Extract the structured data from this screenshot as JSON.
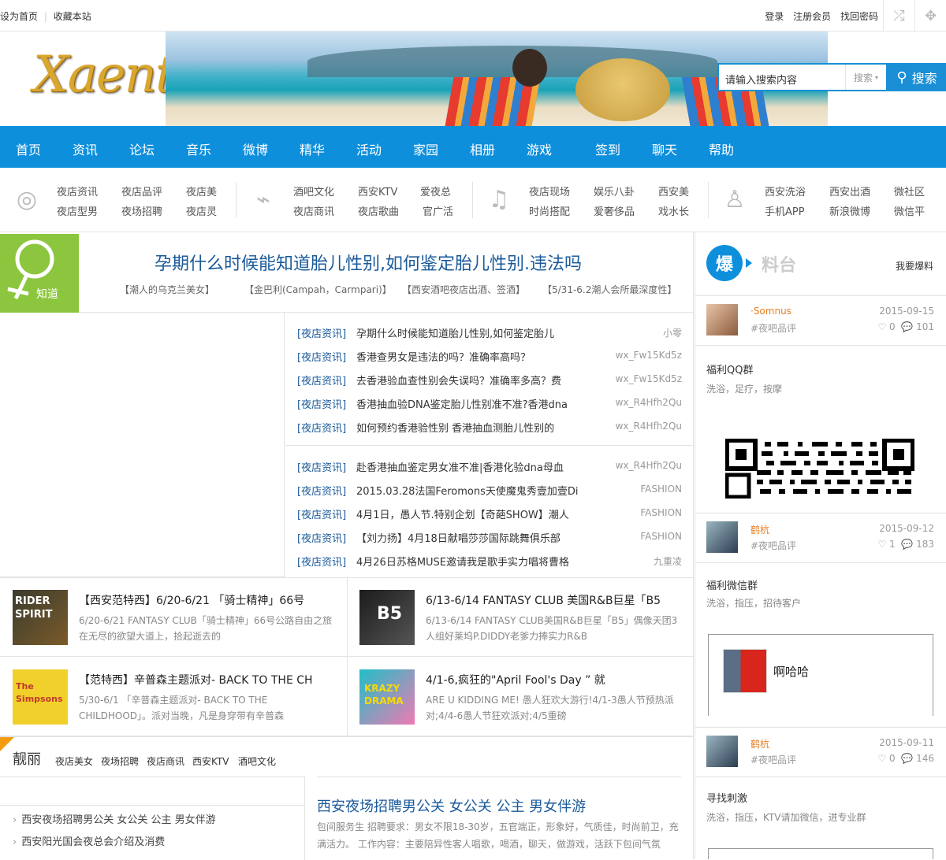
{
  "topbar": {
    "left": [
      "设为首页",
      "收藏本站"
    ],
    "right": [
      "登录",
      "注册会员",
      "找回密码"
    ]
  },
  "logo": {
    "text": "Xaent"
  },
  "search": {
    "placeholder": "请输入搜索内容",
    "select": "搜索",
    "button": "搜索"
  },
  "nav": [
    "首页",
    "资讯",
    "论坛",
    "音乐",
    "微博",
    "精华",
    "活动",
    "家园",
    "相册",
    "游戏",
    "签到",
    "聊天",
    "帮助"
  ],
  "subnav": {
    "g1": [
      "夜店资讯",
      "夜店品评",
      "夜店美",
      "夜店型男",
      "夜场招聘",
      "夜店灵"
    ],
    "g2": [
      "酒吧文化",
      "西安KTV",
      "爱夜总",
      "夜店商讯",
      "夜店歌曲",
      "官广活"
    ],
    "g3": [
      "夜店现场",
      "娱乐八卦",
      "西安美",
      "时尚搭配",
      "爱奢侈品",
      "戏水长"
    ],
    "g4": [
      "西安洗浴",
      "西安出酒",
      "微社区",
      "手机APP",
      "新浪微博",
      "微信平"
    ]
  },
  "featured": {
    "badge": "知道",
    "title": "孕期什么时候能知道胎儿性别,如何鉴定胎儿性别.违法吗",
    "tags": [
      "【潮人的乌克兰美女】",
      "【金巴利(Campah，Carmpari)】",
      "【西安酒吧夜店出酒、签酒】",
      "【5/31-6.2潮人会所最深度性】"
    ]
  },
  "news1": [
    {
      "cat": "[夜店资讯]",
      "title": "孕期什么时候能知道胎儿性别,如何鉴定胎儿",
      "author": "小零"
    },
    {
      "cat": "[夜店资讯]",
      "title": "香港查男女是违法的吗？准确率高吗？",
      "author": "wx_Fw15Kd5z"
    },
    {
      "cat": "[夜店资讯]",
      "title": "去香港验血查性别会失误吗？准确率多高？费",
      "author": "wx_Fw15Kd5z"
    },
    {
      "cat": "[夜店资讯]",
      "title": "香港抽血验DNA鉴定胎儿性别准不准?香港dna",
      "author": "wx_R4Hfh2Qu"
    },
    {
      "cat": "[夜店资讯]",
      "title": "如何预约香港验性别 香港抽血测胎儿性别的",
      "author": "wx_R4Hfh2Qu"
    }
  ],
  "news2": [
    {
      "cat": "[夜店资讯]",
      "title": "赴香港抽血鉴定男女准不准|香港化验dna母血",
      "author": "wx_R4Hfh2Qu"
    },
    {
      "cat": "[夜店资讯]",
      "title": "2015.03.28法国Feromons天使魔鬼秀壹加壹Di",
      "author": "FASHION"
    },
    {
      "cat": "[夜店资讯]",
      "title": "4月1日，愚人节.特别企划【奇葩SHOW】潮人",
      "author": "FASHION"
    },
    {
      "cat": "[夜店资讯]",
      "title": "【刘力扬】4月18日献唱莎莎国际跳舞俱乐部",
      "author": "FASHION"
    },
    {
      "cat": "[夜店资讯]",
      "title": "4月26日苏格MUSE邀请我是歌手实力唱将曹格",
      "author": "九重凌"
    }
  ],
  "cards": [
    {
      "title": "【西安范特西】6/20-6/21 「骑士精神」66号",
      "desc": "6/20-6/21 FANTASY CLUB「骑士精神」66号公路自由之旅在无尽的欲望大道上，拾起逝去的",
      "thumb": "RIDER SPIRIT"
    },
    {
      "title": "6/13-6/14 FANTASY CLUB 美国R&B巨星「B5",
      "desc": "6/13-6/14 FANTASY CLUB美国R&B巨星「B5」偶像天团3人组好莱坞P.DIDDY老爹力捧实力R&B",
      "thumb": "B5"
    },
    {
      "title": "【范特西】辛普森主题派对- BACK TO THE CH",
      "desc": "5/30-6/1 「辛普森主题派对- BACK TO THE CHILDHOOD」。派对当晚，凡是身穿带有辛普森",
      "thumb": "The Simpsons"
    },
    {
      "title": "4/1-6,疯狂的\"April Fool's Day ” 就",
      "desc": "ARE U KIDDING ME! 愚人狂欢大游行!4/1-3愚人节预热派对;4/4-6愚人节狂欢派对;4/5重磅",
      "thumb": "KRAZY DRAMA"
    }
  ],
  "liangli": {
    "heading": "靓丽",
    "tabs": [
      "夜店美女",
      "夜场招聘",
      "夜店商讯",
      "西安KTV",
      "酒吧文化"
    ],
    "list": [
      "西安夜场招聘男公关 女公关 公主 男女伴游",
      "西安阳光国会夜总会介绍及消费"
    ],
    "big_title": "西安夜场招聘男公关 女公关 公主 男女伴游",
    "desc": "包间服务生 招聘要求：男女不限18-30岁，五官端正，形象好，气质佳，时尚前卫，充满活力。 工作内容：主要陪异性客人唱歌，喝酒，聊天，做游戏，活跃下包间气氛"
  },
  "sidebar": {
    "badge": "爆",
    "badge_text": "料台",
    "link": "我要爆料",
    "posts": [
      {
        "name": "·Somnus",
        "cat": "#夜吧品评",
        "date": "2015-09-15",
        "likes": "0",
        "comments": "101"
      },
      {
        "name": "鹤杭",
        "cat": "#夜吧品评",
        "date": "2015-09-12",
        "likes": "1",
        "comments": "183"
      },
      {
        "name": "鹤杭",
        "cat": "#夜吧品评",
        "date": "2015-09-11",
        "likes": "0",
        "comments": "146"
      }
    ],
    "blocks": [
      {
        "title": "福利QQ群",
        "sub": "洗浴，足疗，按摩"
      },
      {
        "title": "福利微信群",
        "sub": "洗浴，指压，招待客户"
      },
      {
        "title": "寻找刺激",
        "sub": "洗浴，指压，KTV请加微信，进专业群"
      }
    ],
    "chat_name": "啊哈哈"
  }
}
